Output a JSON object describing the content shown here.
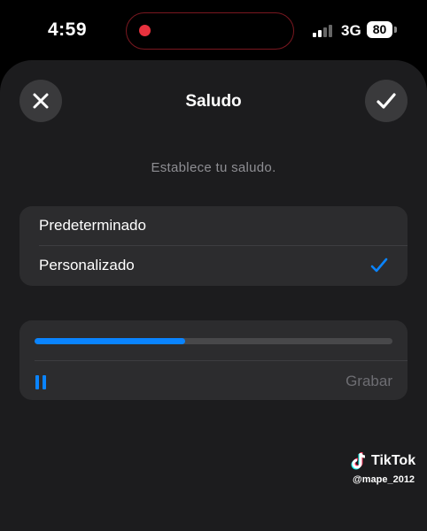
{
  "status_bar": {
    "time": "4:59",
    "network": "3G",
    "battery": "80"
  },
  "sheet": {
    "title": "Saludo",
    "subtitle": "Establece tu saludo.",
    "close_icon": "close-icon",
    "done_icon": "checkmark-icon"
  },
  "options": [
    {
      "label": "Predeterminado",
      "selected": false
    },
    {
      "label": "Personalizado",
      "selected": true
    }
  ],
  "player": {
    "progress": 0.42,
    "state": "playing",
    "record_label": "Grabar"
  },
  "watermark": {
    "brand": "TikTok",
    "user": "@mape_2012"
  },
  "colors": {
    "accent": "#0a84ff",
    "sheet_bg": "#1c1c1e",
    "card_bg": "#2c2c2e",
    "recording_dot": "#e8323e"
  }
}
